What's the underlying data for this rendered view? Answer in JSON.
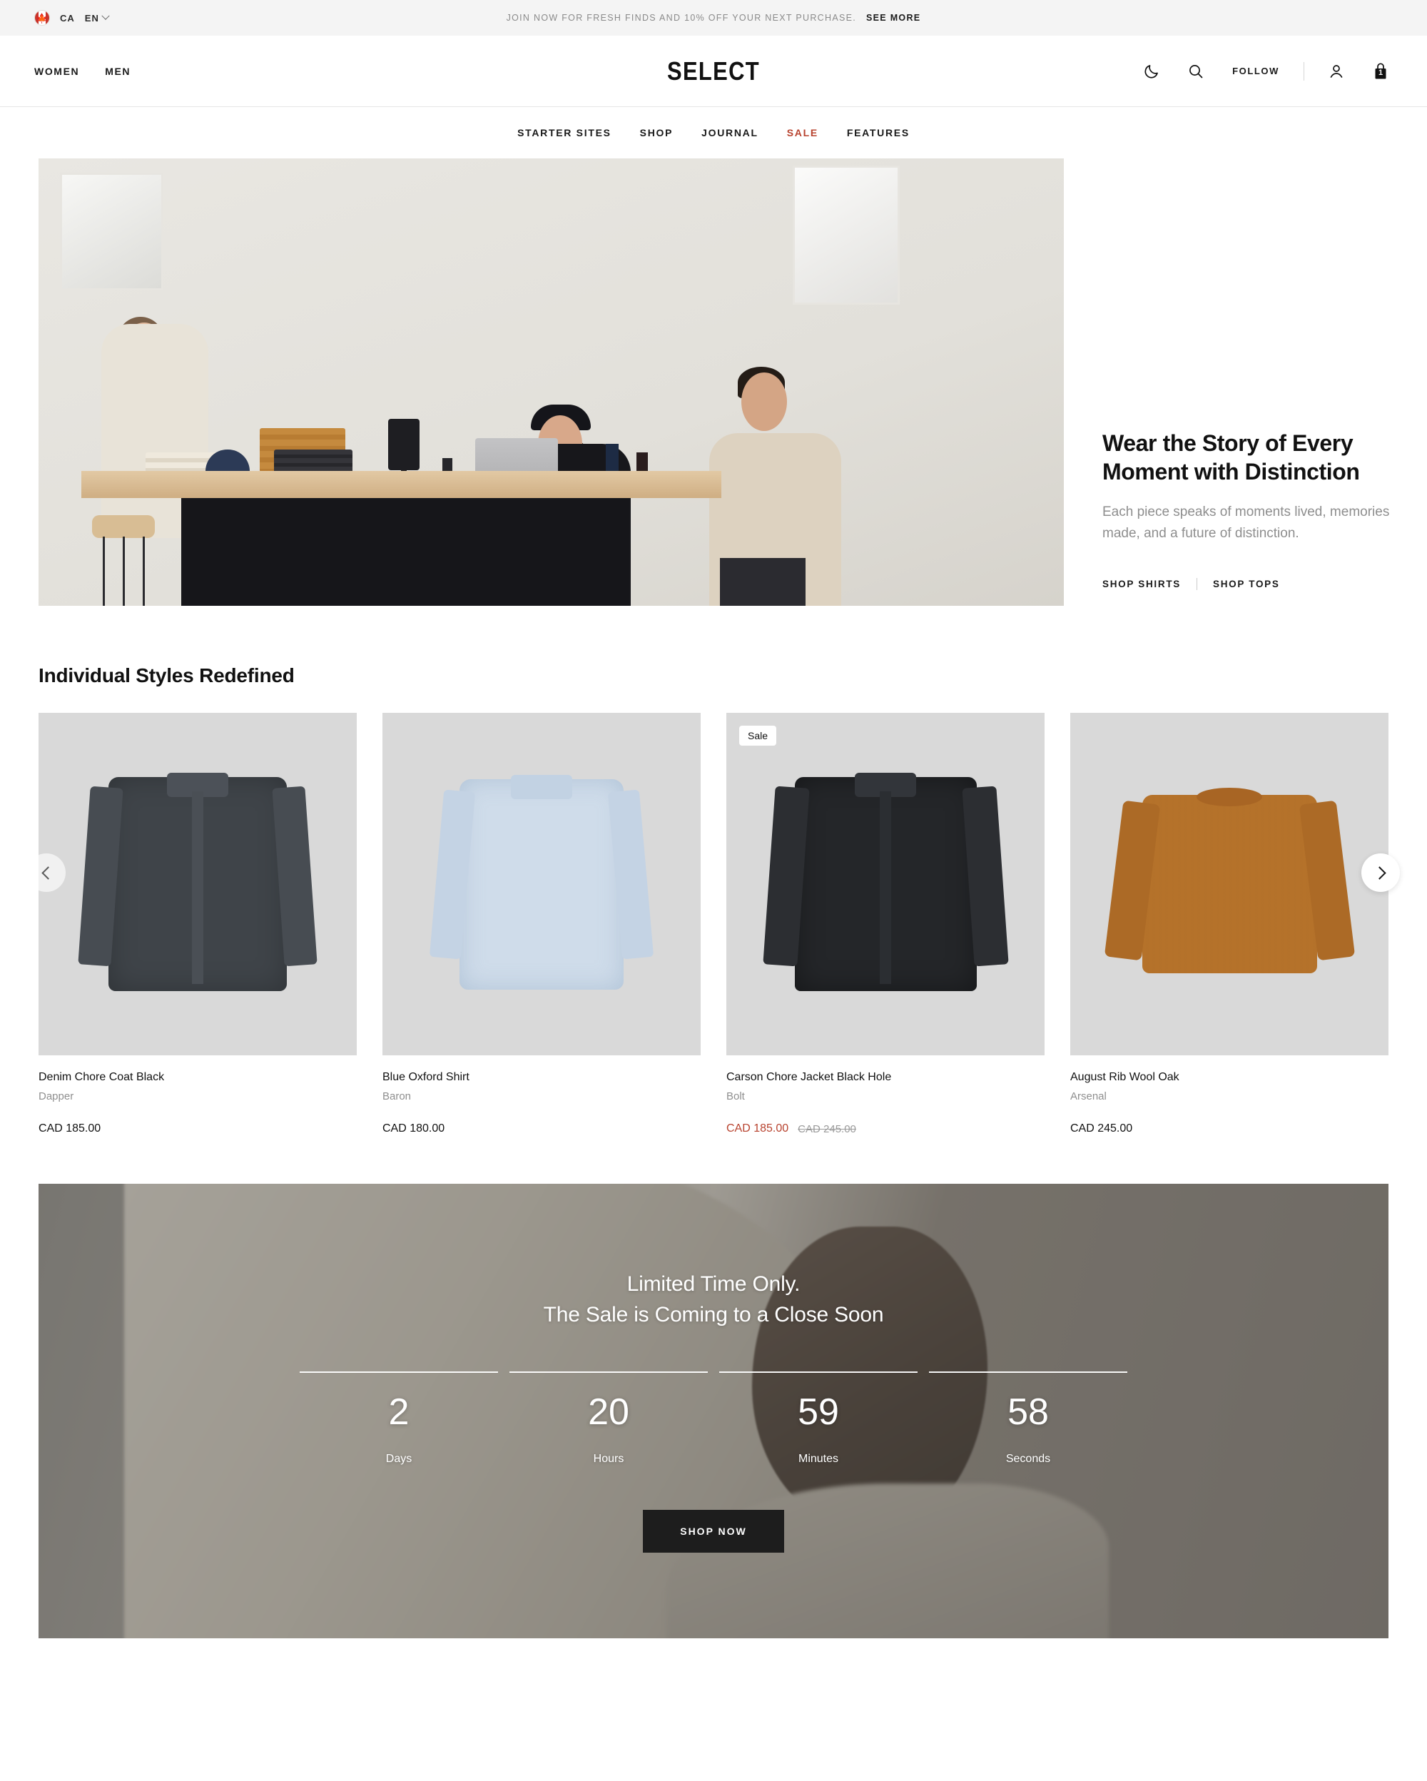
{
  "announcement": {
    "locale_country": "CA",
    "locale_language": "EN",
    "flag_icon": "canada-flag-icon",
    "message": "JOIN NOW FOR FRESH FINDS AND 10% OFF YOUR NEXT PURCHASE.",
    "link_label": "SEE MORE"
  },
  "header": {
    "brand": "SELECT",
    "left_nav": [
      {
        "label": "WOMEN"
      },
      {
        "label": "MEN"
      }
    ],
    "follow_label": "FOLLOW",
    "icons": {
      "dark_mode": "moon-icon",
      "search": "search-icon",
      "account": "user-icon",
      "cart": "shopping-bag-icon"
    },
    "cart_count": "1"
  },
  "sub_nav": [
    {
      "label": "STARTER SITES",
      "active": false
    },
    {
      "label": "SHOP",
      "active": false
    },
    {
      "label": "JOURNAL",
      "active": false
    },
    {
      "label": "SALE",
      "active": true
    },
    {
      "label": "FEATURES",
      "active": false
    }
  ],
  "hero": {
    "title": "Wear the Story of Every Moment with Distinction",
    "subtitle": "Each piece speaks of moments lived, memories made, and a future of distinction.",
    "link_primary": "SHOP SHIRTS",
    "link_secondary": "SHOP TOPS"
  },
  "products": {
    "section_title": "Individual Styles Redefined",
    "prev_label": "Previous",
    "next_label": "Next",
    "items": [
      {
        "name": "Denim Chore Coat Black",
        "vendor": "Dapper",
        "price": "CAD 185.00",
        "compare_at": null,
        "badge": null,
        "on_sale": false
      },
      {
        "name": "Blue Oxford Shirt",
        "vendor": "Baron",
        "price": "CAD 180.00",
        "compare_at": null,
        "badge": null,
        "on_sale": false
      },
      {
        "name": "Carson Chore Jacket Black Hole",
        "vendor": "Bolt",
        "price": "CAD 185.00",
        "compare_at": "CAD 245.00",
        "badge": "Sale",
        "on_sale": true
      },
      {
        "name": "August Rib Wool Oak",
        "vendor": "Arsenal",
        "price": "CAD 245.00",
        "compare_at": null,
        "badge": null,
        "on_sale": false
      }
    ]
  },
  "countdown": {
    "title": "Limited Time Only.\nThe Sale is Coming to a Close Soon",
    "units": [
      {
        "value": "2",
        "label": "Days"
      },
      {
        "value": "20",
        "label": "Hours"
      },
      {
        "value": "59",
        "label": "Minutes"
      },
      {
        "value": "58",
        "label": "Seconds"
      }
    ],
    "cta_label": "SHOP NOW"
  },
  "colors": {
    "sale_accent": "#b8432f",
    "text_primary": "#1a1a1a",
    "text_muted": "#8e8e8e",
    "announce_bg": "#f4f4f4",
    "product_bg": "#d9d9d9",
    "cta_bg": "#1d1d1d"
  }
}
